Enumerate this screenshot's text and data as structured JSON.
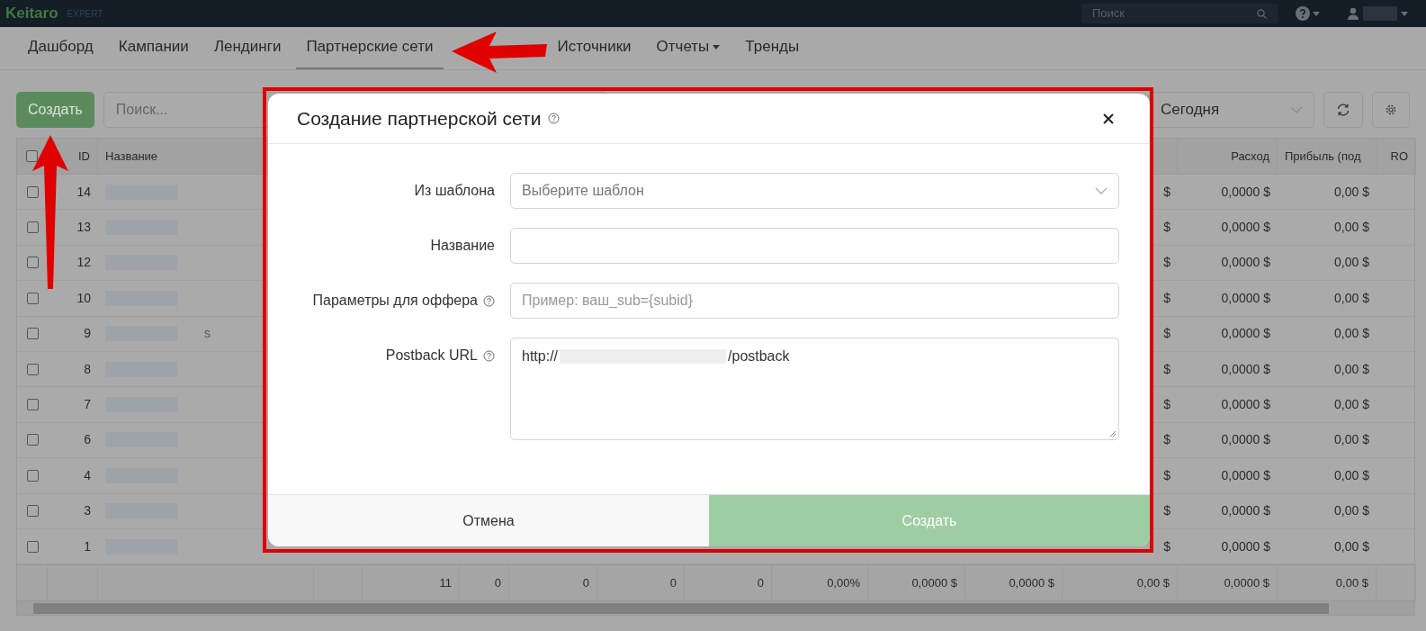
{
  "top_bar": {
    "logo": "Keitaro",
    "edition": "EXPERT",
    "search": {
      "placeholder": "Поиск"
    }
  },
  "nav": [
    {
      "label": "Дашборд",
      "selected": false,
      "kind": "link"
    },
    {
      "label": "Кампании",
      "selected": false,
      "kind": "link"
    },
    {
      "label": "Лендинги",
      "selected": false,
      "kind": "link"
    },
    {
      "label": "Партнерские сети",
      "selected": true,
      "kind": "link"
    },
    {
      "label": "Источники",
      "selected": false,
      "kind": "link"
    },
    {
      "label": "Отчеты",
      "selected": false,
      "kind": "dropdown"
    },
    {
      "label": "Тренды",
      "selected": false,
      "kind": "link"
    }
  ],
  "toolbar": {
    "create_button": "Создать",
    "search": {
      "placeholder": "Поиск..."
    },
    "period": "Сегодня"
  },
  "table": {
    "header": {
      "id": "ID",
      "name": "Название",
      "spend": "Расход",
      "profit": "Прибыль (под",
      "column_16": "RO"
    },
    "all_checked": false,
    "rows": [
      {
        "id": "14",
        "checked": false,
        "spend": "0,0000 $",
        "profit": "0,00 $",
        "column_13": "$"
      },
      {
        "id": "13",
        "checked": false,
        "spend": "0,0000 $",
        "profit": "0,00 $",
        "column_13": "$"
      },
      {
        "id": "12",
        "checked": false,
        "spend": "0,0000 $",
        "profit": "0,00 $",
        "column_13": "$"
      },
      {
        "id": "10",
        "checked": false,
        "spend": "0,0000 $",
        "profit": "0,00 $",
        "column_13": "$"
      },
      {
        "id": "9",
        "checked": false,
        "name_fragment": "s",
        "spend": "0,0000 $",
        "profit": "0,00 $",
        "column_13": "$"
      },
      {
        "id": "8",
        "checked": false,
        "spend": "0,0000 $",
        "profit": "0,00 $",
        "column_13": "$"
      },
      {
        "id": "7",
        "checked": false,
        "spend": "0,0000 $",
        "profit": "0,00 $",
        "column_13": "$"
      },
      {
        "id": "6",
        "checked": false,
        "spend": "0,0000 $",
        "profit": "0,00 $",
        "column_13": "$"
      },
      {
        "id": "4",
        "checked": false,
        "spend": "0,0000 $",
        "profit": "0,00 $",
        "column_13": "$"
      },
      {
        "id": "3",
        "checked": false,
        "spend": "0,0000 $",
        "profit": "0,00 $",
        "column_13": "$"
      },
      {
        "id": "1",
        "checked": false,
        "spend": "0,0000 $",
        "profit": "0,00 $",
        "column_13": "$"
      }
    ],
    "totals": [
      "11",
      "0",
      "0",
      "0",
      "0",
      "0,00%",
      "0,0000 $",
      "0,0000 $",
      "0,00 $",
      "0,0000 $",
      "0,00 $"
    ]
  },
  "modal": {
    "title": "Создание партнерской сети",
    "fields": [
      {
        "label": "Из шаблона",
        "kind": "select",
        "placeholder": "Выберите шаблон",
        "help": false
      },
      {
        "label": "Название",
        "kind": "input",
        "help": false
      },
      {
        "label": "Параметры для оффера",
        "kind": "input",
        "placeholder": "Пример: ваш_sub={subid}",
        "help": true
      },
      {
        "label": "Postback URL",
        "kind": "textarea",
        "value_start": "http://",
        "value_end": "/postback",
        "help": true
      }
    ],
    "cancel": "Отмена",
    "submit": "Создать"
  }
}
